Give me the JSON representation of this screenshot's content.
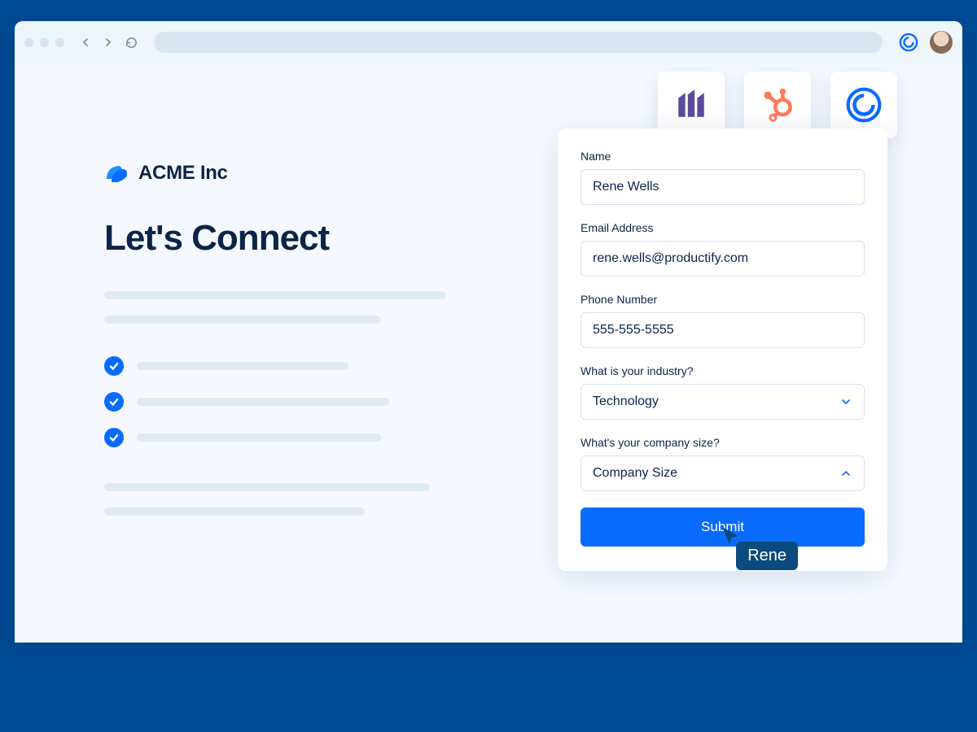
{
  "brand": {
    "name": "ACME Inc"
  },
  "headline": "Let's Connect",
  "integrations": [
    {
      "icon": "marketo-icon"
    },
    {
      "icon": "hubspot-icon"
    },
    {
      "icon": "calendly-icon"
    }
  ],
  "form": {
    "fields": {
      "name": {
        "label": "Name",
        "value": "Rene Wells"
      },
      "email": {
        "label": "Email Address",
        "value": "rene.wells@productify.com"
      },
      "phone": {
        "label": "Phone Number",
        "value": "555-555-5555"
      },
      "industry": {
        "label": "What is your industry?",
        "value": "Technology"
      },
      "company_size": {
        "label": "What's your company size?",
        "value": "Company Size"
      }
    },
    "submit_label": "Submit"
  },
  "cursor_label": "Rene"
}
